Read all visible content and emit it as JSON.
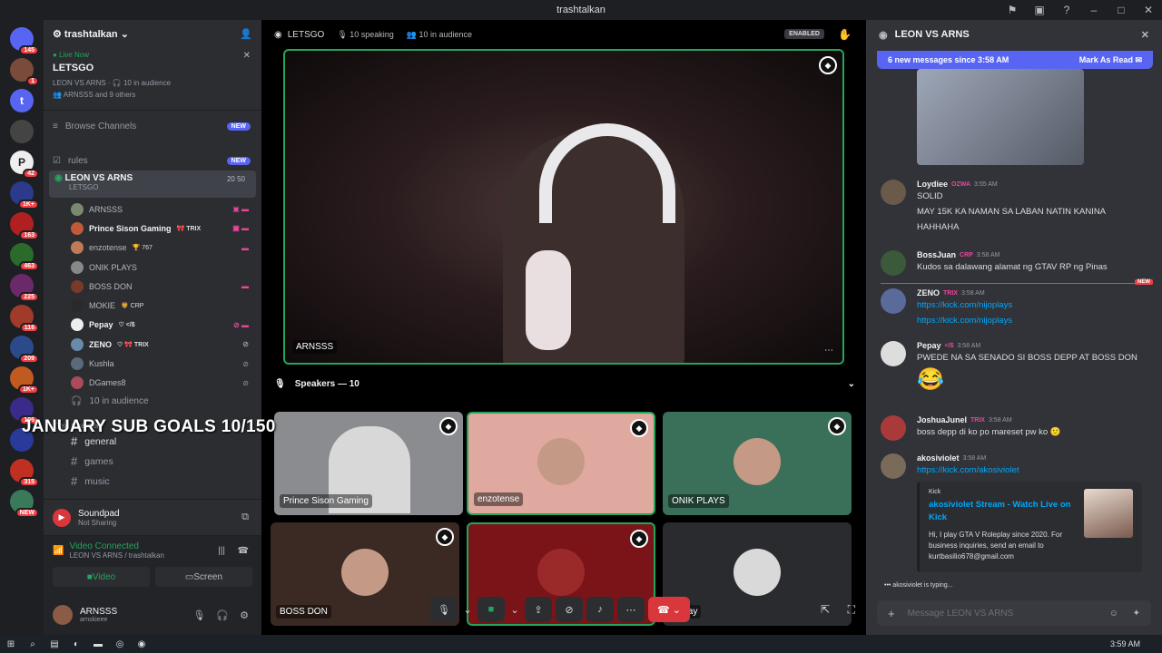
{
  "titlebar": {
    "title": "trashtalkan"
  },
  "guilds": [
    {
      "label": "",
      "badge": "145"
    },
    {
      "label": "",
      "badge": "1"
    },
    {
      "label": "t",
      "badge": ""
    },
    {
      "label": "",
      "badge": ""
    },
    {
      "label": "P",
      "badge": "42"
    },
    {
      "label": "",
      "badge": "1K+"
    },
    {
      "label": "",
      "badge": "163"
    },
    {
      "label": "",
      "badge": "463"
    },
    {
      "label": "",
      "badge": "225"
    },
    {
      "label": "",
      "badge": "116"
    },
    {
      "label": "",
      "badge": "209"
    },
    {
      "label": "",
      "badge": "1K+"
    },
    {
      "label": "",
      "badge": "106"
    },
    {
      "label": "",
      "badge": ""
    },
    {
      "label": "",
      "badge": "315"
    },
    {
      "label": "",
      "badge": "NEW"
    }
  ],
  "server": {
    "name": "trashtalkan"
  },
  "live": {
    "status": "Live Now",
    "title": "LETSGO",
    "meta": "LEON VS ARNS  ·  🎧 10 in audience",
    "with": "ARNSSS and 9 others"
  },
  "channels": {
    "browse": "Browse Channels",
    "browse_pill": "NEW",
    "rules": "rules",
    "rules_pill": "NEW"
  },
  "voice_channel": {
    "name": "LEON VS ARNS",
    "sub": "LETSGO",
    "count": "20  50"
  },
  "members": [
    {
      "name": "ARNSSS",
      "tag": "",
      "icon": "▣ ▬"
    },
    {
      "name": "Prince Sison Gaming",
      "tag": "🎀 TRIX",
      "icon": "▣ ▬"
    },
    {
      "name": "enzotense",
      "tag": "🏆 767",
      "icon": "▬"
    },
    {
      "name": "ONIK PLAYS",
      "tag": "",
      "icon": ""
    },
    {
      "name": "BOSS DON",
      "tag": "",
      "icon": "▬"
    },
    {
      "name": "MOKIE",
      "tag": "🦁 CRP",
      "icon": ""
    },
    {
      "name": "Pepay",
      "tag": "♡ </$",
      "icon": "⊘ ▬"
    },
    {
      "name": "ZENO",
      "tag": "♡ 🎀 TRIX",
      "icon": "⊘"
    },
    {
      "name": "Kushla",
      "tag": "",
      "icon": "⊘"
    },
    {
      "name": "DGames8",
      "tag": "",
      "icon": "⊘"
    }
  ],
  "audience": "10 in audience",
  "overlay": "JANUARY SUB GOALS 10/150",
  "text_category": "Text Channels",
  "text_channels": [
    "general",
    "games",
    "music"
  ],
  "soundpad": {
    "name": "Soundpad",
    "status": "Not Sharing"
  },
  "voice_conn": {
    "status": "Video Connected",
    "where": "LEON VS ARNS / trashtalkan",
    "video": "Video",
    "screen": "Screen"
  },
  "user": {
    "name": "ARNSSS",
    "handle": "arnskieee"
  },
  "stage": {
    "title": "LETSGO",
    "speaking": "10 speaking",
    "audience": "10 in audience",
    "enabled": "ENABLED",
    "featured": "ARNSSS",
    "speakers_label": "Speakers — 10"
  },
  "tiles": [
    {
      "name": "Prince Sison Gaming",
      "color": "#8a8c90"
    },
    {
      "name": "enzotense",
      "color": "#e0a9a0"
    },
    {
      "name": "ONIK PLAYS",
      "color": "#3a7059"
    },
    {
      "name": "BOSS DON",
      "color": "#3b2a23"
    },
    {
      "name": "",
      "color": "#7a1418"
    },
    {
      "name": "Pepay",
      "color": "#2a2b2e"
    }
  ],
  "chat": {
    "title": "LEON VS ARNS",
    "new_msgs": "6 new messages since 3:58 AM",
    "mark_read": "Mark As Read",
    "messages": [
      {
        "author": "Loydiee",
        "role": "OZWA",
        "time": "3:55 AM",
        "lines": [
          "SOLID",
          "MAY 15K KA NAMAN SA LABAN NATIN KANINA",
          "HAHHAHA"
        ],
        "links": []
      },
      {
        "author": "BossJuan",
        "role": "CRP",
        "time": "3:58 AM",
        "lines": [
          "Kudos sa dalawang alamat ng GTAV RP ng Pinas"
        ],
        "links": []
      },
      {
        "author": "ZENO",
        "role": "TRIX",
        "time": "3:58 AM",
        "lines": [],
        "links": [
          "https://kick.com/nijoplays",
          "https://kick.com/nijoplays"
        ]
      },
      {
        "author": "Pepay",
        "role": "</$",
        "time": "3:58 AM",
        "lines": [
          "PWEDE NA SA SENADO SI BOSS DEPP AT BOSS DON",
          "😂"
        ],
        "links": []
      },
      {
        "author": "JoshuaJunel",
        "role": "TRIX",
        "time": "3:58 AM",
        "lines": [
          "boss depp di ko po mareset pw ko 🙁"
        ],
        "links": []
      },
      {
        "author": "akosiviolet",
        "role": "",
        "time": "3:58 AM",
        "lines": [],
        "links": [
          "https://kick.com/akosiviolet"
        ]
      }
    ],
    "new_label": "NEW",
    "embed": {
      "provider": "Kick",
      "title": "akosiviolet Stream - Watch Live on Kick",
      "desc": "Hi, I play GTA V Roleplay since 2020. For business inquiries, send an email to kurtbasilio678@gmail.com"
    },
    "typing": "akosiviolet is typing...",
    "placeholder": "Message LEON VS ARNS"
  },
  "taskbar": {
    "time": "3:59 AM"
  }
}
